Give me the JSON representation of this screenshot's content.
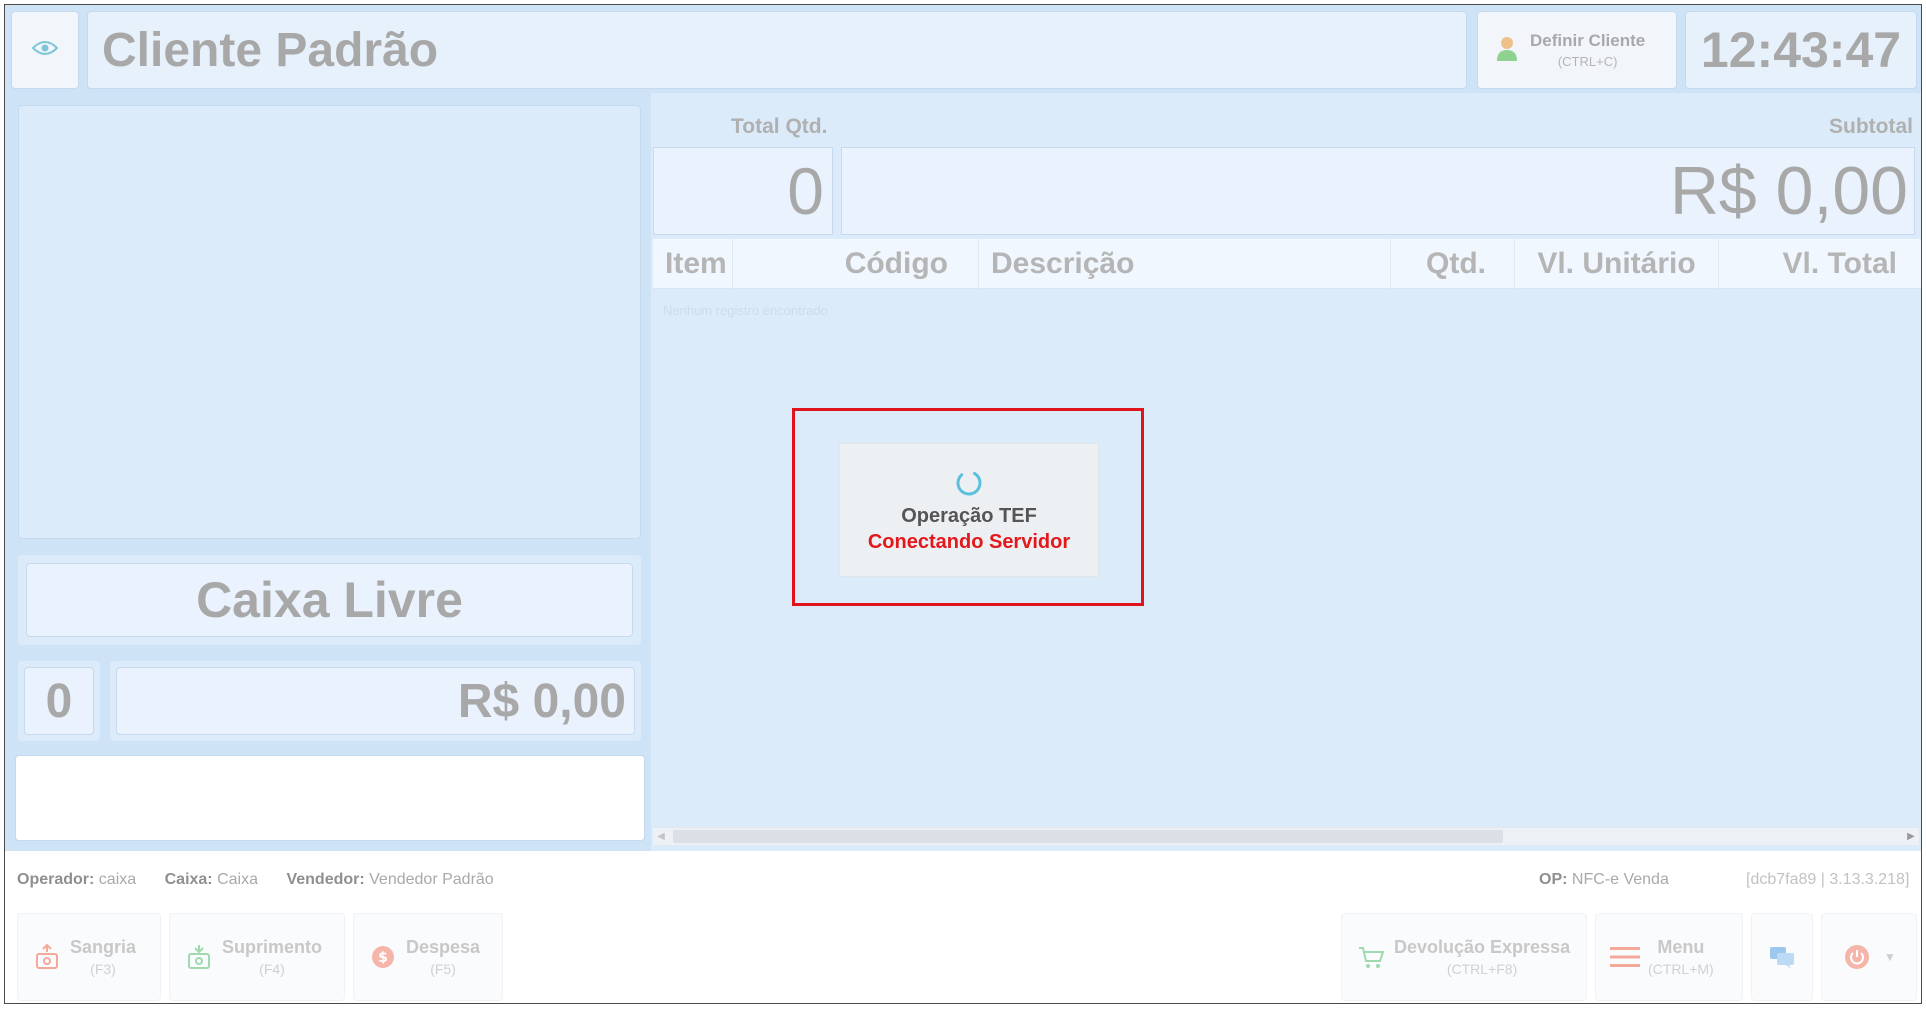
{
  "header": {
    "client_name": "Cliente Padrão",
    "define_client_label": "Definir Cliente",
    "define_client_shortcut": "(CTRL+C)",
    "clock": "12:43:47"
  },
  "left_panel": {
    "status": "Caixa Livre",
    "item_count": "0",
    "amount": "R$ 0,00"
  },
  "summary": {
    "total_qty_label": "Total Qtd.",
    "total_qty_value": "0",
    "subtotal_label": "Subtotal",
    "subtotal_value": "R$ 0,00"
  },
  "table": {
    "columns": [
      "Item",
      "Código",
      "Descrição",
      "Qtd.",
      "Vl. Unitário",
      "Vl. Total"
    ],
    "empty_message": "Nenhum registro encontrado"
  },
  "dialog": {
    "title": "Operação TEF",
    "status": "Conectando Servidor"
  },
  "footer": {
    "operator_label": "Operador:",
    "operator_value": "caixa",
    "cashbox_label": "Caixa:",
    "cashbox_value": "Caixa",
    "seller_label": "Vendedor:",
    "seller_value": "Vendedor Padrão",
    "op_label": "OP:",
    "op_value": "NFC-e Venda",
    "version": "[dcb7fa89 | 3.13.3.218]",
    "buttons": {
      "sangria": {
        "label": "Sangria",
        "shortcut": "(F3)"
      },
      "suprimento": {
        "label": "Suprimento",
        "shortcut": "(F4)"
      },
      "despesa": {
        "label": "Despesa",
        "shortcut": "(F5)"
      },
      "devolucao": {
        "label": "Devolução Expressa",
        "shortcut": "(CTRL+F8)"
      },
      "menu": {
        "label": "Menu",
        "shortcut": "(CTRL+M)"
      }
    }
  },
  "colors": {
    "accent_bg": "#cfe3f7",
    "alert_red": "#e3181c",
    "spinner_teal": "#5bc0de"
  },
  "icons": {
    "eye": "eye-icon",
    "user": "user-icon",
    "spinner": "spinner-icon",
    "sangria": "money-bag-up-icon",
    "suprimento": "money-bag-down-icon",
    "despesa": "coin-dollar-icon",
    "devolucao": "cart-return-icon",
    "menu": "hamburger-icon",
    "chat": "chat-icon",
    "power": "power-icon"
  }
}
